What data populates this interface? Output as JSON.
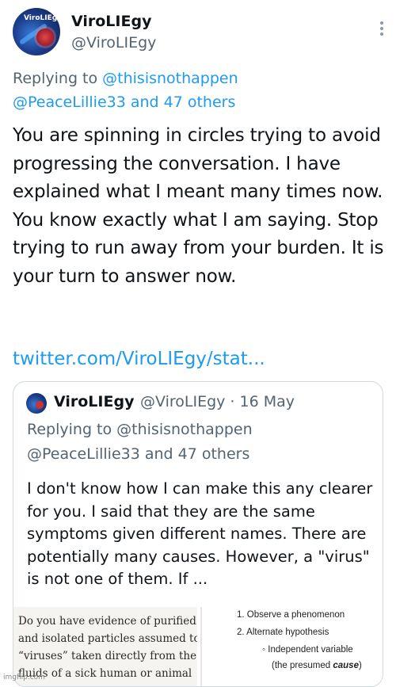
{
  "tweet": {
    "display_name": "ViroLIEgy",
    "handle": "@ViroLIEgy",
    "replying_prefix": "Replying to ",
    "reply_user1": "@thisisnothappen",
    "reply_user2_and_others": "@PeaceLillie33 and 47 others",
    "body": "You are spinning in circles trying to avoid progressing the conversation. I have explained what I meant many times now. You know exactly what I am saying. Stop trying to run away from your burden. It is your turn to answer now.",
    "link_text": "twitter.com/ViroLIEgy/stat..."
  },
  "quoted": {
    "display_name": "ViroLIEgy",
    "meta": "@ViroLIEgy · 16 May",
    "replying_line1": "Replying to @thisisnothappen",
    "replying_line2": "@PeaceLillie33 and 47 others",
    "body": "I don't know how I can make this any clearer for you. I said that they are the same symptoms given different names. There are potentially many causes. However, a \"virus\" is not one of them. If ...",
    "image_left_lines": [
      "Do you have evidence of purified",
      "and isolated particles assumed to",
      "“viruses” taken directly from the",
      "fluids of a sick human or animal"
    ],
    "image_right": {
      "line1": "1. Observe a phenomenon",
      "line2": "2. Alternate hypothesis",
      "line3": "◦ Independent variable",
      "line4_prefix": "(the presumed ",
      "line4_em": "cause",
      "line4_suffix": ")"
    }
  },
  "avatar_tag": "ViroLIEgy",
  "watermark": "imgflip.com",
  "colors": {
    "link": "#1d9bf0",
    "muted": "#536471",
    "text": "#0f1419",
    "border": "#cfd9de"
  },
  "icons": [
    "more-options-icon"
  ]
}
